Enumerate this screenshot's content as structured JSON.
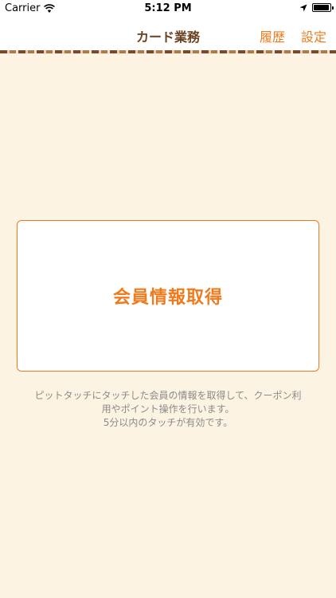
{
  "status_bar": {
    "carrier": "Carrier",
    "time": "5:12 PM",
    "wifi_icon": "wifi-icon",
    "location_icon": "location-arrow-icon",
    "battery_icon": "battery-icon",
    "battery_level": 0.95
  },
  "nav": {
    "title": "カード業務",
    "history_label": "履歴",
    "settings_label": "設定",
    "title_color": "#6a4220",
    "accent_color": "#ee7b1e"
  },
  "main": {
    "card_button_label": "会員情報取得",
    "description_lines": [
      "ピットタッチにタッチした会員の情報を取得して、クーポン利",
      "用やポイント操作を行います。",
      "5分以内のタッチが有効です。"
    ]
  }
}
